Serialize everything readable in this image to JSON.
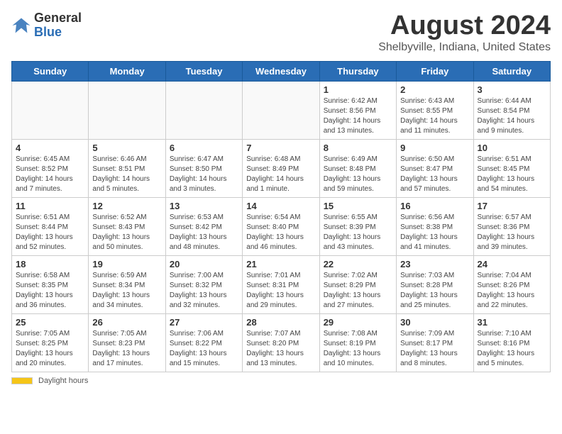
{
  "logo": {
    "general": "General",
    "blue": "Blue"
  },
  "title": "August 2024",
  "subtitle": "Shelbyville, Indiana, United States",
  "days_of_week": [
    "Sunday",
    "Monday",
    "Tuesday",
    "Wednesday",
    "Thursday",
    "Friday",
    "Saturday"
  ],
  "footer": {
    "daylight_label": "Daylight hours"
  },
  "weeks": [
    [
      {
        "day": "",
        "info": ""
      },
      {
        "day": "",
        "info": ""
      },
      {
        "day": "",
        "info": ""
      },
      {
        "day": "",
        "info": ""
      },
      {
        "day": "1",
        "info": "Sunrise: 6:42 AM\nSunset: 8:56 PM\nDaylight: 14 hours\nand 13 minutes."
      },
      {
        "day": "2",
        "info": "Sunrise: 6:43 AM\nSunset: 8:55 PM\nDaylight: 14 hours\nand 11 minutes."
      },
      {
        "day": "3",
        "info": "Sunrise: 6:44 AM\nSunset: 8:54 PM\nDaylight: 14 hours\nand 9 minutes."
      }
    ],
    [
      {
        "day": "4",
        "info": "Sunrise: 6:45 AM\nSunset: 8:52 PM\nDaylight: 14 hours\nand 7 minutes."
      },
      {
        "day": "5",
        "info": "Sunrise: 6:46 AM\nSunset: 8:51 PM\nDaylight: 14 hours\nand 5 minutes."
      },
      {
        "day": "6",
        "info": "Sunrise: 6:47 AM\nSunset: 8:50 PM\nDaylight: 14 hours\nand 3 minutes."
      },
      {
        "day": "7",
        "info": "Sunrise: 6:48 AM\nSunset: 8:49 PM\nDaylight: 14 hours\nand 1 minute."
      },
      {
        "day": "8",
        "info": "Sunrise: 6:49 AM\nSunset: 8:48 PM\nDaylight: 13 hours\nand 59 minutes."
      },
      {
        "day": "9",
        "info": "Sunrise: 6:50 AM\nSunset: 8:47 PM\nDaylight: 13 hours\nand 57 minutes."
      },
      {
        "day": "10",
        "info": "Sunrise: 6:51 AM\nSunset: 8:45 PM\nDaylight: 13 hours\nand 54 minutes."
      }
    ],
    [
      {
        "day": "11",
        "info": "Sunrise: 6:51 AM\nSunset: 8:44 PM\nDaylight: 13 hours\nand 52 minutes."
      },
      {
        "day": "12",
        "info": "Sunrise: 6:52 AM\nSunset: 8:43 PM\nDaylight: 13 hours\nand 50 minutes."
      },
      {
        "day": "13",
        "info": "Sunrise: 6:53 AM\nSunset: 8:42 PM\nDaylight: 13 hours\nand 48 minutes."
      },
      {
        "day": "14",
        "info": "Sunrise: 6:54 AM\nSunset: 8:40 PM\nDaylight: 13 hours\nand 46 minutes."
      },
      {
        "day": "15",
        "info": "Sunrise: 6:55 AM\nSunset: 8:39 PM\nDaylight: 13 hours\nand 43 minutes."
      },
      {
        "day": "16",
        "info": "Sunrise: 6:56 AM\nSunset: 8:38 PM\nDaylight: 13 hours\nand 41 minutes."
      },
      {
        "day": "17",
        "info": "Sunrise: 6:57 AM\nSunset: 8:36 PM\nDaylight: 13 hours\nand 39 minutes."
      }
    ],
    [
      {
        "day": "18",
        "info": "Sunrise: 6:58 AM\nSunset: 8:35 PM\nDaylight: 13 hours\nand 36 minutes."
      },
      {
        "day": "19",
        "info": "Sunrise: 6:59 AM\nSunset: 8:34 PM\nDaylight: 13 hours\nand 34 minutes."
      },
      {
        "day": "20",
        "info": "Sunrise: 7:00 AM\nSunset: 8:32 PM\nDaylight: 13 hours\nand 32 minutes."
      },
      {
        "day": "21",
        "info": "Sunrise: 7:01 AM\nSunset: 8:31 PM\nDaylight: 13 hours\nand 29 minutes."
      },
      {
        "day": "22",
        "info": "Sunrise: 7:02 AM\nSunset: 8:29 PM\nDaylight: 13 hours\nand 27 minutes."
      },
      {
        "day": "23",
        "info": "Sunrise: 7:03 AM\nSunset: 8:28 PM\nDaylight: 13 hours\nand 25 minutes."
      },
      {
        "day": "24",
        "info": "Sunrise: 7:04 AM\nSunset: 8:26 PM\nDaylight: 13 hours\nand 22 minutes."
      }
    ],
    [
      {
        "day": "25",
        "info": "Sunrise: 7:05 AM\nSunset: 8:25 PM\nDaylight: 13 hours\nand 20 minutes."
      },
      {
        "day": "26",
        "info": "Sunrise: 7:05 AM\nSunset: 8:23 PM\nDaylight: 13 hours\nand 17 minutes."
      },
      {
        "day": "27",
        "info": "Sunrise: 7:06 AM\nSunset: 8:22 PM\nDaylight: 13 hours\nand 15 minutes."
      },
      {
        "day": "28",
        "info": "Sunrise: 7:07 AM\nSunset: 8:20 PM\nDaylight: 13 hours\nand 13 minutes."
      },
      {
        "day": "29",
        "info": "Sunrise: 7:08 AM\nSunset: 8:19 PM\nDaylight: 13 hours\nand 10 minutes."
      },
      {
        "day": "30",
        "info": "Sunrise: 7:09 AM\nSunset: 8:17 PM\nDaylight: 13 hours\nand 8 minutes."
      },
      {
        "day": "31",
        "info": "Sunrise: 7:10 AM\nSunset: 8:16 PM\nDaylight: 13 hours\nand 5 minutes."
      }
    ]
  ]
}
